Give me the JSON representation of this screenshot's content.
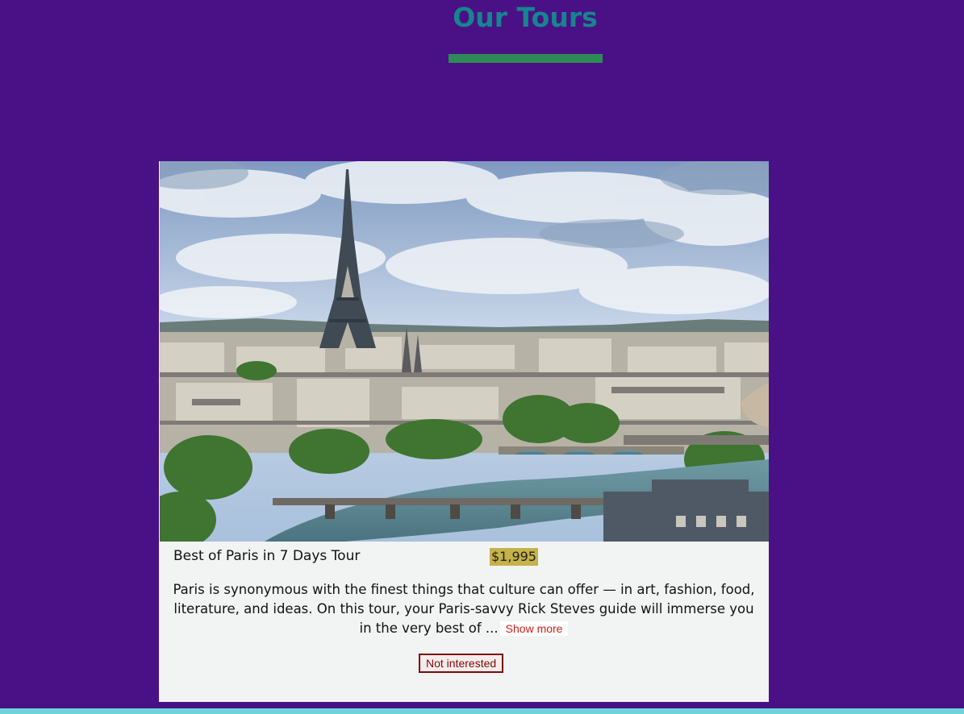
{
  "page": {
    "title": "Our Tours"
  },
  "tour": {
    "name": "Best of Paris in 7 Days Tour",
    "price": "$1,995",
    "description": "Paris is synonymous with the finest things that culture can offer — in art, fashion, food, literature, and ideas. On this tour, your Paris-savvy Rick Steves guide will immerse you in the very best of ...",
    "show_more_label": "Show more",
    "not_interested_label": "Not interested"
  },
  "colors": {
    "background": "#4a1186",
    "title": "#16858f",
    "underline": "#2e8b57",
    "card": "#f1f4f3",
    "price_badge": "#c6b24a",
    "show_more_text": "#d41b1b",
    "danger": "#7a0a0a",
    "bottom_bar": "#6fd3d9"
  }
}
